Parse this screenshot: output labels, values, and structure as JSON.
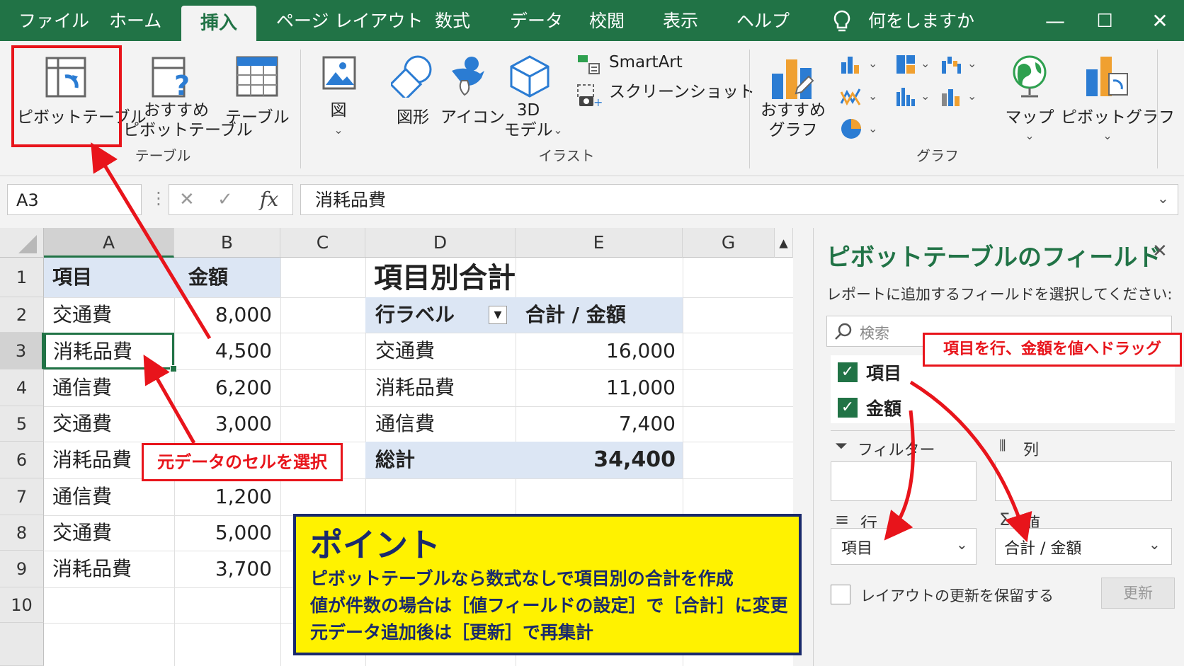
{
  "tabs": [
    "ファイル",
    "ホーム",
    "挿入",
    "ページ レイアウト",
    "数式",
    "データ",
    "校閲",
    "表示",
    "ヘルプ"
  ],
  "tell_me": "何をしますか",
  "window": {
    "minimize": "—",
    "restore": "☐",
    "close": "✕"
  },
  "ribbon": {
    "pivot_table": "ピボットテーブル",
    "recommended_pivot_1": "おすすめ",
    "recommended_pivot_2": "ピボットテーブル",
    "table": "テーブル",
    "group_table": "テーブル",
    "picture": "図",
    "shapes": "図形",
    "icons": "アイコン",
    "model3d_1": "3D",
    "model3d_2": "モデル",
    "smartart": "SmartArt",
    "screenshot": "スクリーンショット",
    "group_illust": "イラスト",
    "rec_chart_1": "おすすめ",
    "rec_chart_2": "グラフ",
    "map": "マップ",
    "pivot_chart": "ピボットグラフ",
    "group_chart": "グラフ",
    "caret": "⌄"
  },
  "formula_bar": {
    "name_box": "A3",
    "cancel": "✕",
    "enter": "✓",
    "fx": "fx",
    "content": "消耗品費"
  },
  "columns": [
    "A",
    "B",
    "C",
    "D",
    "E",
    "G"
  ],
  "rows": [
    "1",
    "2",
    "3",
    "4",
    "5",
    "6",
    "7",
    "8",
    "9",
    "10"
  ],
  "table": {
    "header_item": "項目",
    "header_amount": "金額",
    "data": [
      {
        "item": "交通費",
        "amount": "8,000"
      },
      {
        "item": "消耗品費",
        "amount": "4,500"
      },
      {
        "item": "通信費",
        "amount": "6,200"
      },
      {
        "item": "交通費",
        "amount": "3,000"
      },
      {
        "item": "消耗品費",
        "amount": ""
      },
      {
        "item": "通信費",
        "amount": "1,200"
      },
      {
        "item": "交通費",
        "amount": "5,000"
      },
      {
        "item": "消耗品費",
        "amount": "3,700"
      }
    ]
  },
  "pivot": {
    "title": "項目別合計",
    "row_label": "行ラベル",
    "sum_label": "合計 / 金額",
    "rows": [
      {
        "label": "交通費",
        "value": "16,000"
      },
      {
        "label": "消耗品費",
        "value": "11,000"
      },
      {
        "label": "通信費",
        "value": "7,400"
      }
    ],
    "total_label": "総計",
    "total_value": "34,400"
  },
  "fields_pane": {
    "title": "ピボットテーブルのフィールド",
    "close": "✕",
    "subtitle": "レポートに追加するフィールドを選択してください:",
    "search_placeholder": "検索",
    "field1": "項目",
    "field2": "金額",
    "filter": "フィルター",
    "columns": "列",
    "rows": "行",
    "values": "値",
    "rows_value": "項目",
    "values_value": "合計 / 金額",
    "defer": "レイアウトの更新を保留する",
    "update": "更新"
  },
  "callouts": {
    "select_cell": "元データのセルを選択",
    "drag": "項目を行、金額を値へドラッグ"
  },
  "point": {
    "heading": "ポイント",
    "line1": "ピボットテーブルなら数式なしで項目別の合計を作成",
    "line2": "値が件数の場合は［値フィールドの設定］で［合計］に変更",
    "line3": "元データ追加後は［更新］で再集計"
  },
  "colors": {
    "excel_green": "#217346",
    "red": "#e8141b",
    "header_blue": "#dce6f4",
    "yellow": "#fff200",
    "navy": "#1a2a6c"
  }
}
